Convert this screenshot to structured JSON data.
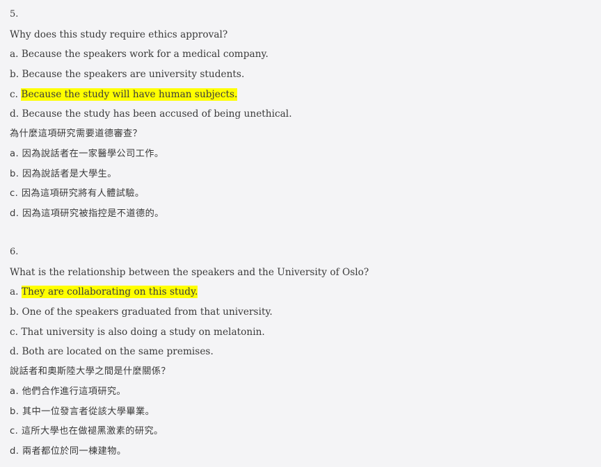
{
  "questions": [
    {
      "number": "5.",
      "question_en": "Why does this study require ethics approval?",
      "options_en": [
        {
          "prefix": "a.",
          "text": "Because the speakers work for a medical company."
        },
        {
          "prefix": "b.",
          "text": "Because the speakers are university students."
        },
        {
          "prefix": "c.",
          "text": "Because the study will have human subjects."
        },
        {
          "prefix": "d.",
          "text": "Because the study has been accused of being unethical."
        }
      ],
      "question_zh": "為什麼這項研究需要道德審查？",
      "options_zh": [
        "a. 因為說話者在一家醫學公司工作。",
        "b. 因為說話者是大學生。",
        "c. 因為這項研究將有人體試驗。",
        "d. 因為這項研究被指控是不道德的。"
      ]
    },
    {
      "number": "6.",
      "question_en": "What is the relationship between the speakers and the University of Oslo?",
      "options_en": [
        {
          "prefix": "a.",
          "text": "They are collaborating on this study."
        },
        {
          "prefix": "b.",
          "text": "One of the speakers graduated from that university."
        },
        {
          "prefix": "c.",
          "text": "That university is also doing a study on melatonin."
        },
        {
          "prefix": "d.",
          "text": "Both are located on the same premises."
        }
      ],
      "question_zh": "說話者和奧斯陸大學之間是什麼關係？",
      "options_zh": [
        "a. 他們合作進行這項研究。",
        "b. 其中一位發言者從該大學畢業。",
        "c. 這所大學也在做褪黑激素的研究。",
        "d. 兩者都位於同一棟建物。"
      ]
    }
  ],
  "highlight_color": "#ffff00"
}
